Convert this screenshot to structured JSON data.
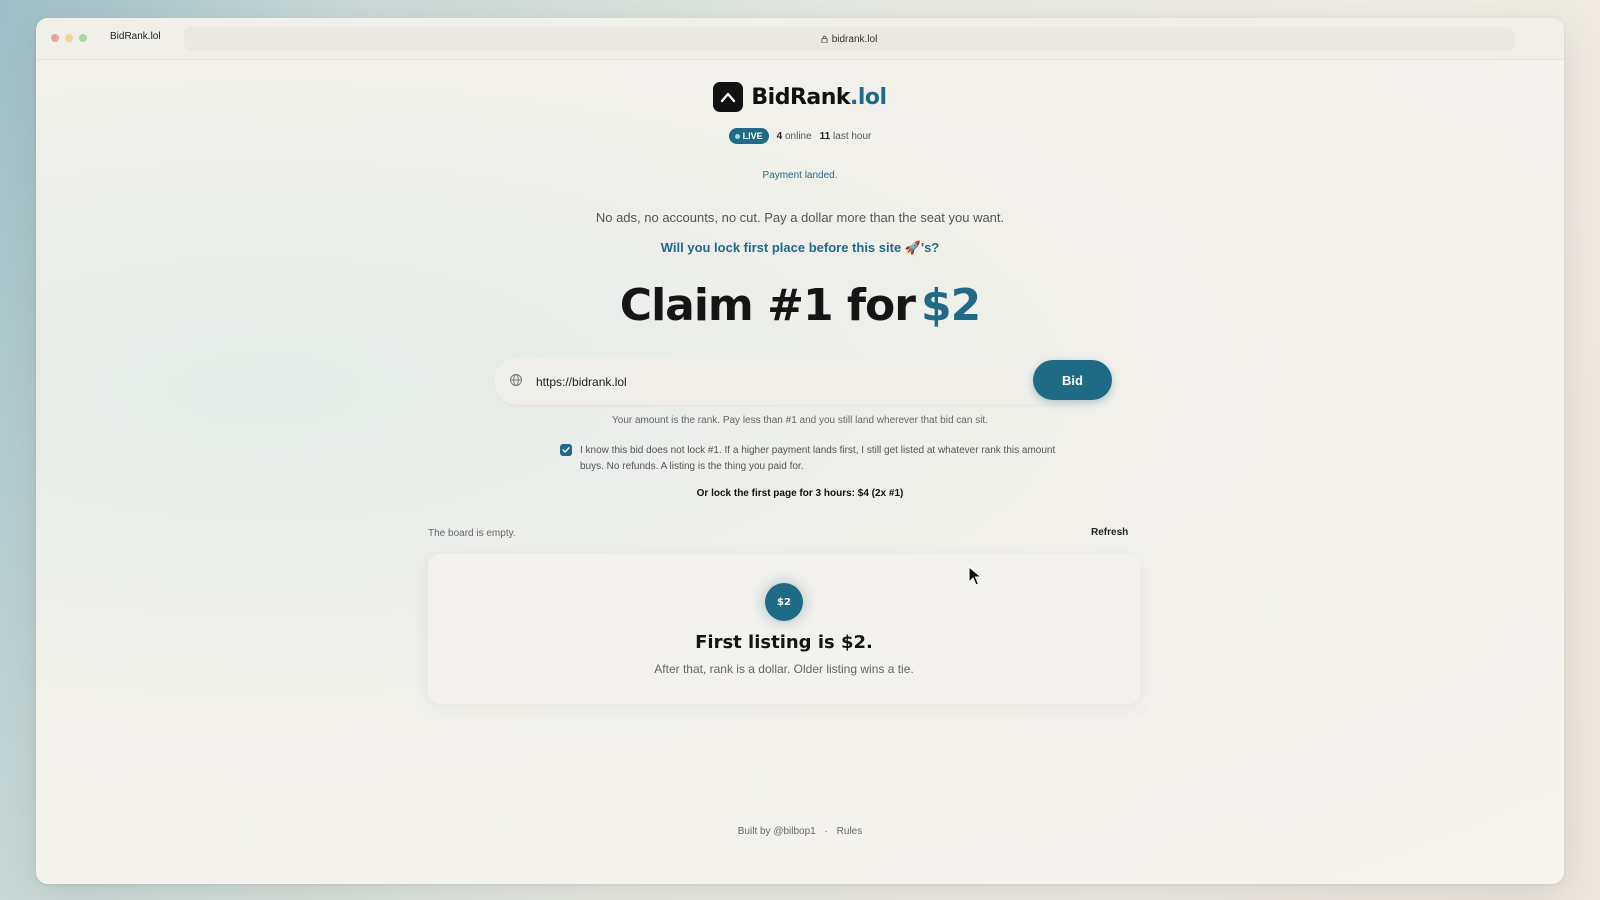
{
  "browser": {
    "tab_title": "BidRank.lol",
    "url": "bidrank.lol"
  },
  "brand": {
    "name": "BidRank",
    "tld": ".lol"
  },
  "status": {
    "live_label": "LIVE",
    "online_count": "4",
    "online_label": "online",
    "last_hour_count": "11",
    "last_hour_label": "last hour"
  },
  "payment_notice": "Payment landed.",
  "tagline": "No ads, no accounts, no cut. Pay a dollar more than the seat you want.",
  "question": "Will you lock first place before this site 🚀's?",
  "headline": {
    "text": "Claim #1 for",
    "amount": "$2"
  },
  "bid_form": {
    "url_value": "https://bidrank.lol",
    "button_label": "Bid"
  },
  "hint": "Your amount is the rank. Pay less than #1 and you still land wherever that bid can sit.",
  "agree": {
    "checked": true,
    "text": "I know this bid does not lock #1. If a higher payment lands first, I still get listed at whatever rank this amount buys. No refunds. A listing is the thing you paid for."
  },
  "lock_offer": "Or lock the first page for 3 hours: $4 (2x #1)",
  "board": {
    "empty_label": "The board is empty.",
    "refresh_label": "Refresh"
  },
  "card": {
    "badge": "$2",
    "title": "First listing is $2.",
    "subtitle": "After that, rank is a dollar. Older listing wins a tie."
  },
  "footer": {
    "built_by": "Built by @bilbop1",
    "separator": "·",
    "rules": "Rules"
  },
  "colors": {
    "accent": "#1f6b86",
    "text_dark": "#151515",
    "traffic_red": "#f0a39b",
    "traffic_yellow": "#f1d49a",
    "traffic_green": "#a9d6a6"
  }
}
